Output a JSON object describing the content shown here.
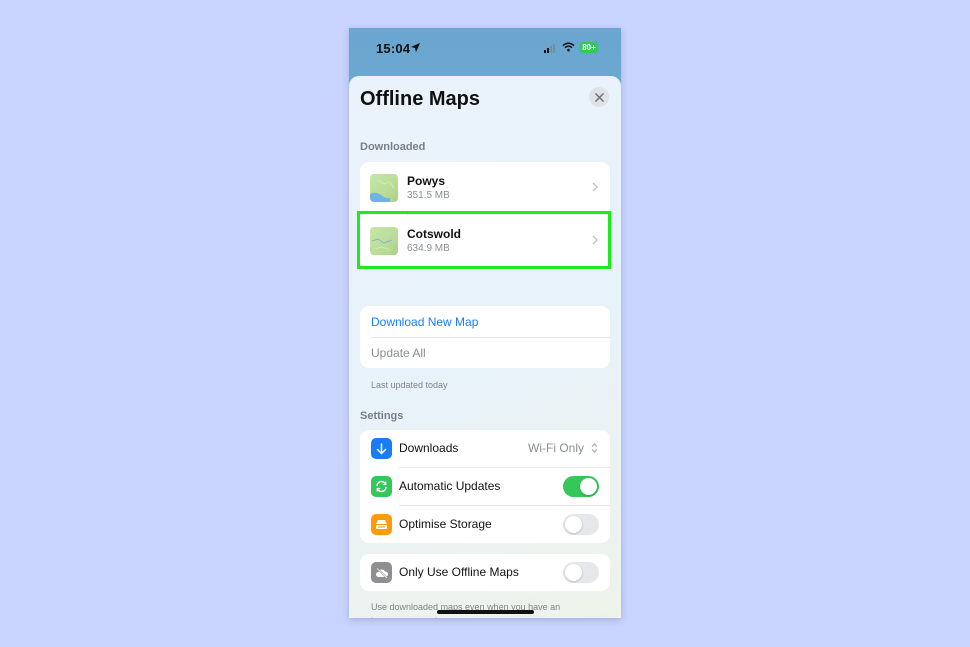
{
  "status_bar": {
    "time": "15:04",
    "battery": "80+"
  },
  "sheet": {
    "title": "Offline Maps",
    "close_icon": "close-icon"
  },
  "downloaded": {
    "section_label": "Downloaded",
    "maps": [
      {
        "name": "Powys",
        "size": "351.5 MB"
      },
      {
        "name": "Cotswold",
        "size": "634.9 MB",
        "highlighted": true
      }
    ]
  },
  "actions": {
    "download_new": "Download New Map",
    "update_all": "Update All",
    "last_updated": "Last updated today"
  },
  "settings": {
    "section_label": "Settings",
    "rows": [
      {
        "label": "Downloads",
        "value": "Wi-Fi Only",
        "icon": "download-arrow-icon",
        "icon_color": "#1a7cf5"
      },
      {
        "label": "Automatic Updates",
        "toggle": true,
        "icon": "refresh-icon",
        "icon_color": "#34c759"
      },
      {
        "label": "Optimise Storage",
        "toggle": false,
        "icon": "storage-icon",
        "icon_color": "#ff9a0a"
      }
    ],
    "offline_only": {
      "label": "Only Use Offline Maps",
      "toggle": false,
      "icon": "cloud-off-icon",
      "icon_color": "#8e8e93",
      "footnote": "Use downloaded maps even when you have an internet connection"
    }
  },
  "colors": {
    "accent_link": "#1a7cf5",
    "toggle_on": "#34c759",
    "highlight_box": "#1eea1e",
    "page_background": "#c8d3fe"
  }
}
